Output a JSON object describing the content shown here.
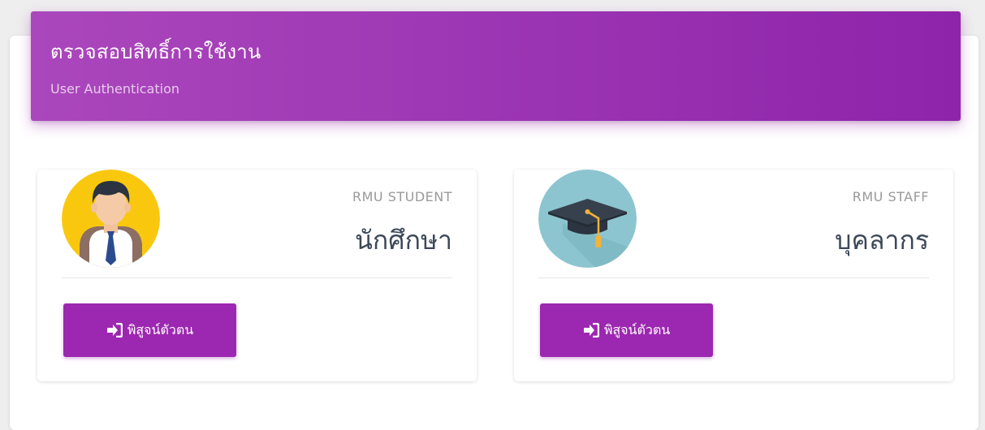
{
  "header": {
    "title": "ตรวจสอบสิทธิ์การใช้งาน",
    "subtitle": "User Authentication"
  },
  "cards": [
    {
      "category": "RMU STUDENT",
      "name": "นักศึกษา",
      "avatar_icon": "student-avatar-icon",
      "button_icon": "sign-in-icon",
      "button_label": "พิสูจน์ตัวตน"
    },
    {
      "category": "RMU STAFF",
      "name": "บุคลากร",
      "avatar_icon": "graduation-cap-icon",
      "button_icon": "sign-in-icon",
      "button_label": "พิสูจน์ตัวตน"
    }
  ],
  "colors": {
    "accent": "#9c27b0",
    "header_gradient_start": "#ab47bc",
    "header_gradient_end": "#8e24aa",
    "student_avatar_bg": "#f9c80e",
    "staff_avatar_bg": "#8cc5cf"
  }
}
